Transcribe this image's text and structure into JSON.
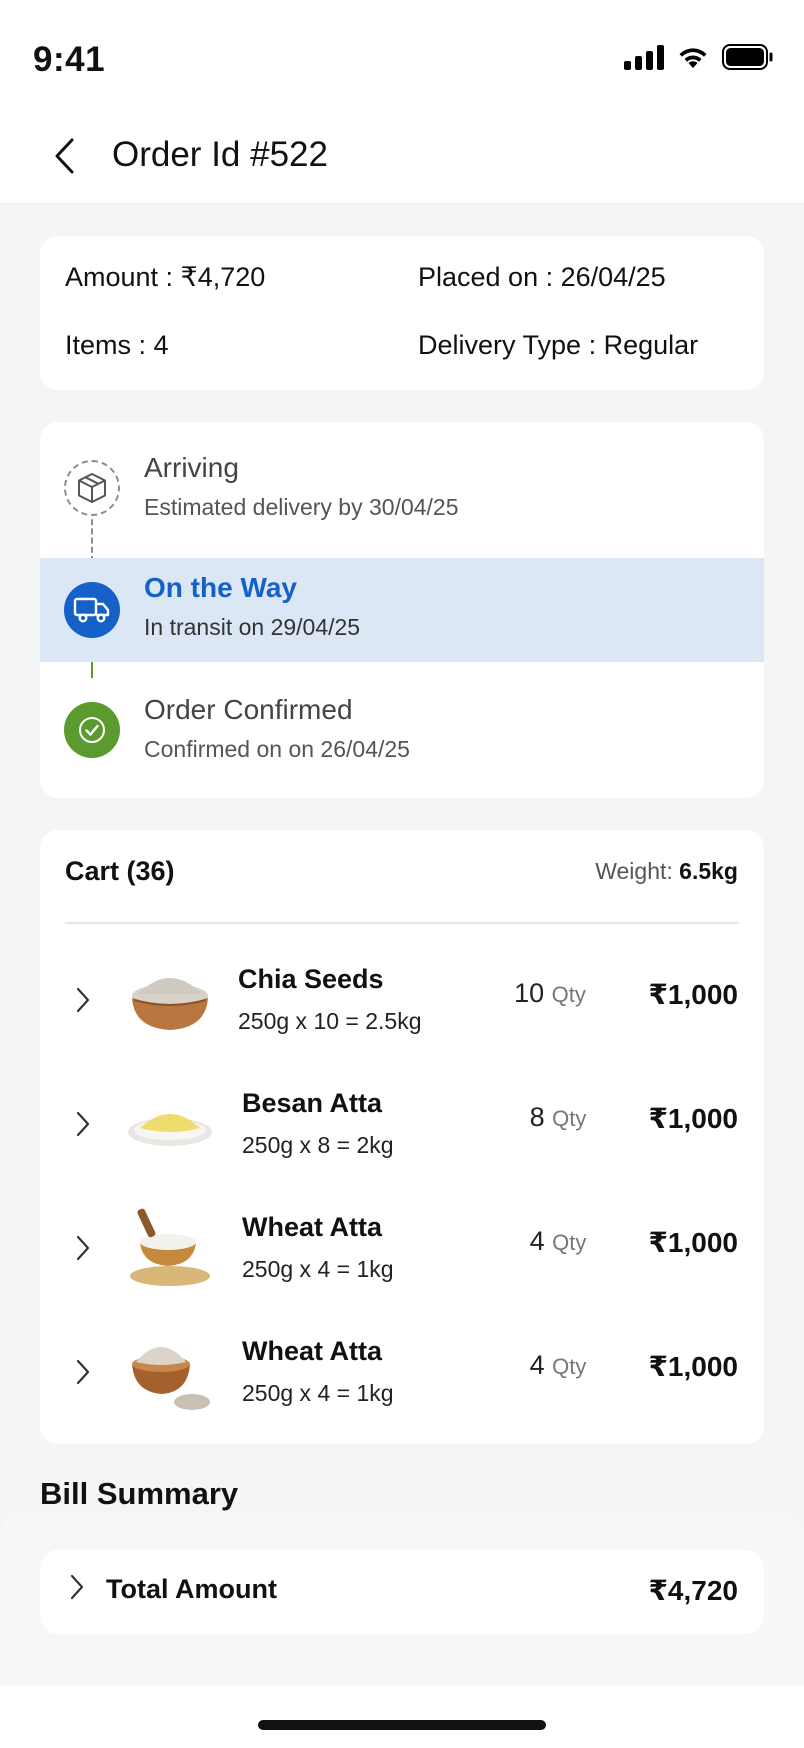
{
  "status_bar": {
    "time": "9:41"
  },
  "header": {
    "title": "Order Id #522"
  },
  "summary": {
    "amount": "Amount : ₹4,720",
    "placed_on": "Placed on : 26/04/25",
    "items": "Items : 4",
    "delivery_type": "Delivery Type : Regular"
  },
  "tracking": [
    {
      "title": "Arriving",
      "subtitle": "Estimated delivery by 30/04/25",
      "state": "pending",
      "icon": "box-icon"
    },
    {
      "title": "On the Way",
      "subtitle": "In transit on 29/04/25",
      "state": "active",
      "icon": "truck-icon"
    },
    {
      "title": "Order Confirmed",
      "subtitle": "Confirmed on on 26/04/25",
      "state": "done",
      "icon": "check-icon"
    }
  ],
  "cart": {
    "title": "Cart (36)",
    "weight_label": "Weight:",
    "weight_value": "6.5kg",
    "items": [
      {
        "name": "Chia Seeds",
        "detail": "250g x 10 = 2.5kg",
        "qty": "10",
        "qty_unit": "Qty",
        "price": "₹1,000"
      },
      {
        "name": "Besan Atta",
        "detail": "250g x 8 = 2kg",
        "qty": "8",
        "qty_unit": "Qty",
        "price": "₹1,000"
      },
      {
        "name": "Wheat Atta",
        "detail": "250g x 4 = 1kg",
        "qty": "4",
        "qty_unit": "Qty",
        "price": "₹1,000"
      },
      {
        "name": "Wheat Atta",
        "detail": "250g x 4 = 1kg",
        "qty": "4",
        "qty_unit": "Qty",
        "price": "₹1,000"
      }
    ]
  },
  "bill": {
    "heading": "Bill Summary",
    "total_label": "Total Amount",
    "total_value": "₹4,720"
  },
  "colors": {
    "active_blue": "#1561c8",
    "success_green": "#5a9a2e",
    "active_row_bg": "#dbe7f4"
  }
}
